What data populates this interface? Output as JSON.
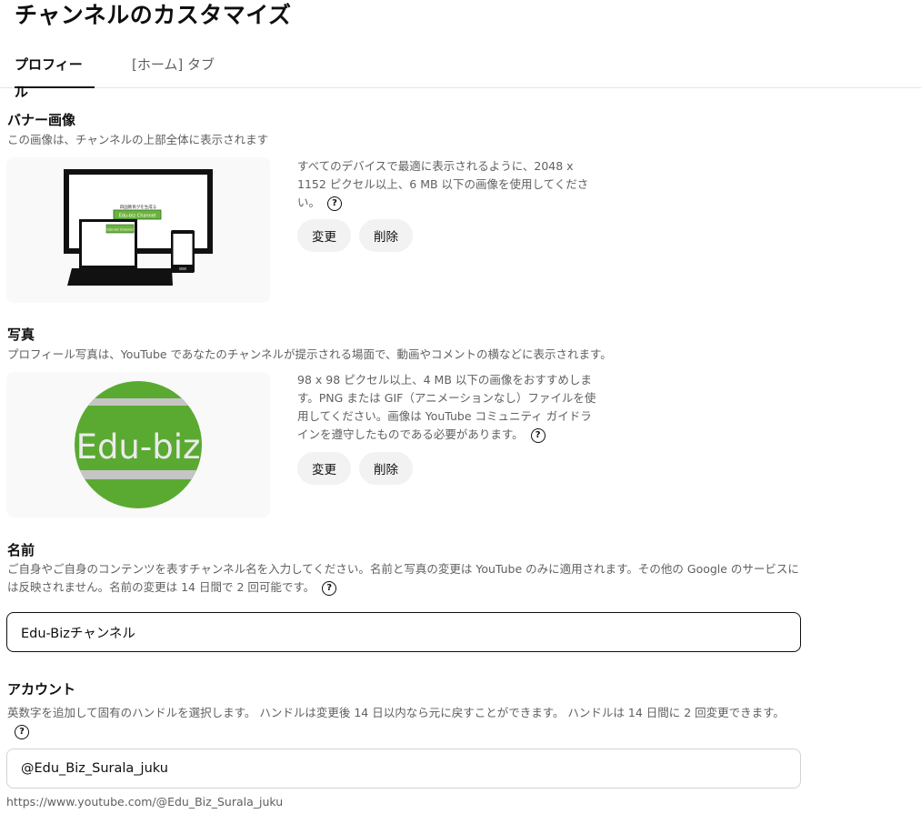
{
  "page": {
    "title": "チャンネルのカスタマイズ"
  },
  "tabs": [
    {
      "label": "プロフィール"
    },
    {
      "label": "[ホーム] タブ"
    }
  ],
  "banner": {
    "title": "バナー画像",
    "description": "この画像は、チャンネルの上部全体に表示されます",
    "help_text": "すべてのデバイスで最適に表示されるように、2048 x 1152 ピクセル以上、6 MB 以下の画像を使用してください。",
    "change_label": "変更",
    "delete_label": "削除",
    "preview_caption": "四国教育がを生成る",
    "preview_logo": "Edu-biz Channel"
  },
  "photo": {
    "title": "写真",
    "description": "プロフィール写真は、YouTube であなたのチャンネルが提示される場面で、動画やコメントの横などに表示されます。",
    "help_text": "98 x 98 ピクセル以上、4 MB 以下の画像をおすすめします。PNG または GIF（アニメーションなし）ファイルを使用してください。画像は YouTube コミュニティ ガイドラインを遵守したものである必要があります。",
    "change_label": "変更",
    "delete_label": "削除",
    "avatar_text": "Edu-biz",
    "avatar_color": "#5aaa32"
  },
  "name": {
    "title": "名前",
    "description": "ご自身やご自身のコンテンツを表すチャンネル名を入力してください。名前と写真の変更は YouTube のみに適用されます。その他の Google のサービスには反映されません。名前の変更は 14 日間で 2 回可能です。",
    "value": "Edu-Bizチャンネル"
  },
  "account": {
    "title": "アカウント",
    "description": "英数字を追加して固有のハンドルを選択します。 ハンドルは変更後 14 日以内なら元に戻すことができます。 ハンドルは 14 日間に 2 回変更できます。",
    "handle_value": "@Edu_Biz_Surala_juku",
    "url": "https://www.youtube.com/@Edu_Biz_Surala_juku"
  },
  "icons": {
    "help": "help-circle-icon"
  }
}
